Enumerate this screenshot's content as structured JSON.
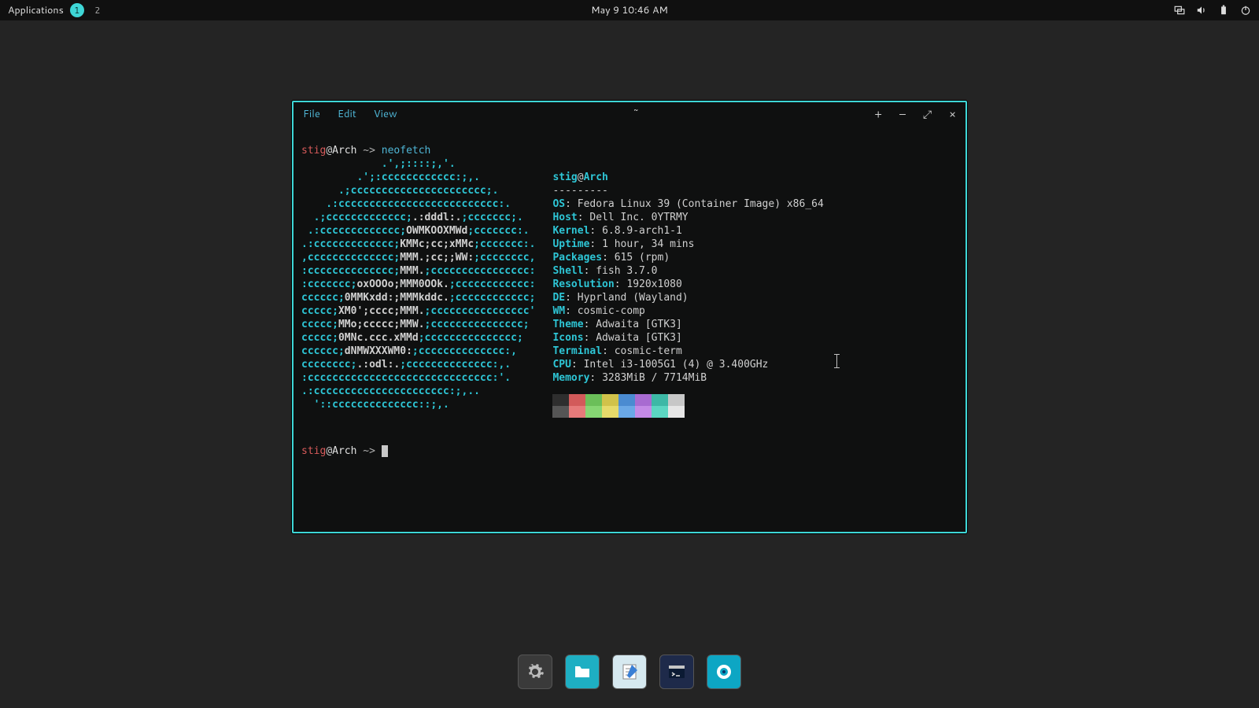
{
  "panel": {
    "applications_label": "Applications",
    "ws1": "1",
    "ws2": "2",
    "clock": "May 9 10:46 AM"
  },
  "tray": {
    "screen": "screen-icon",
    "volume": "volume-icon",
    "battery": "battery-icon",
    "power": "power-icon"
  },
  "window": {
    "menu_file": "File",
    "menu_edit": "Edit",
    "menu_view": "View",
    "title": "~",
    "btn_newtab": "+",
    "btn_min": "–",
    "btn_max": "⤢",
    "btn_close": "×"
  },
  "shell": {
    "prompt_user": "stig",
    "prompt_at": "@",
    "prompt_host": "Arch",
    "prompt_path": "~>",
    "command": "neofetch"
  },
  "neofetch": {
    "header_user": "stig",
    "header_at": "@",
    "header_host": "Arch",
    "dashes": "---------",
    "os_label": "OS",
    "os_value": "Fedora Linux 39 (Container Image) x86_64",
    "host_label": "Host",
    "host_value": "Dell Inc. 0YTRMY",
    "kernel_label": "Kernel",
    "kernel_value": "6.8.9-arch1-1",
    "uptime_label": "Uptime",
    "uptime_value": "1 hour, 34 mins",
    "packages_label": "Packages",
    "packages_value": "615 (rpm)",
    "shell_label": "Shell",
    "shell_value": "fish 3.7.0",
    "resolution_label": "Resolution",
    "resolution_value": "1920x1080",
    "de_label": "DE",
    "de_value": "Hyprland (Wayland)",
    "wm_label": "WM",
    "wm_value": "cosmic-comp",
    "theme_label": "Theme",
    "theme_value": "Adwaita [GTK3]",
    "icons_label": "Icons",
    "icons_value": "Adwaita [GTK3]",
    "terminal_label": "Terminal",
    "terminal_value": "cosmic-term",
    "cpu_label": "CPU",
    "cpu_value": "Intel i3-1005G1 (4) @ 3.400GHz",
    "memory_label": "Memory",
    "memory_value": "3283MiB / 7714MiB",
    "palette_row1": [
      "#2e2e2e",
      "#d25a5a",
      "#6bbf59",
      "#d1c24a",
      "#4a8bd1",
      "#a86bd1",
      "#3db8a6",
      "#c7c7c7"
    ],
    "palette_row2": [
      "#555555",
      "#e67a7a",
      "#86d673",
      "#e6da6a",
      "#6aa8e6",
      "#c48ae6",
      "#5bd6c2",
      "#e6e6e6"
    ]
  },
  "ascii": {
    "l1": "             .',;::::;,'.",
    "l2": "         .';:cccccccccccc:;,.",
    "l3": "      .;cccccccccccccccccccccc;.",
    "l4": "    .:cccccccccccccccccccccccccc:.",
    "l5a": {
      "pre": "  .;ccccccccccccc;",
      "mid": ".:dddl:.",
      "post": ";ccccccc;."
    },
    "l6a": {
      "pre": " .:ccccccccccccc;",
      "mid": "OWMKOOXMWd",
      "post": ";ccccccc:."
    },
    "l7a": {
      "pre": ".:ccccccccccccc;",
      "mid": "KMMc;cc;xMMc",
      "post": ";ccccccc:."
    },
    "l8a": {
      "pre": ",cccccccccccccc;",
      "mid": "MMM.;cc;;WW:",
      "post": ";cccccccc,"
    },
    "l9a": {
      "pre": ":cccccccccccccc;",
      "mid": "MMM.",
      "post": ";cccccccccccccccc:"
    },
    "l10a": {
      "pre": ":ccccccc;",
      "mid": "oxOOOo;MMM0OOk.",
      "post": ";cccccccccccc:"
    },
    "l11a": {
      "pre": "cccccc;",
      "mid": "0MMKxdd:;MMMkddc.",
      "post": ";cccccccccccc;"
    },
    "l12a": {
      "pre": "ccccc;",
      "mid": "XM0';cccc;MMM.",
      "post": ";cccccccccccccccc'"
    },
    "l13a": {
      "pre": "ccccc;",
      "mid": "MMo;ccccc;MMW.",
      "post": ";ccccccccccccccc;"
    },
    "l14a": {
      "pre": "ccccc;",
      "mid": "0MNc.ccc.xMMd",
      "post": ";ccccccccccccccc;"
    },
    "l15a": {
      "pre": "cccccc;",
      "mid": "dNMWXXXWM0:",
      "post": ";cccccccccccccc:,"
    },
    "l16a": {
      "pre": "cccccccc;",
      "mid": ".:odl:.",
      "post": ";cccccccccccccc:,."
    },
    "l17": ":cccccccccccccccccccccccccccccc:'.",
    "l18": ".:cccccccccccccccccccccc:;,..",
    "l19": "  '::cccccccccccccc::;,."
  },
  "dock": {
    "settings": "settings-icon",
    "files": "files-icon",
    "editor": "editor-icon",
    "terminal": "terminal-icon",
    "camera": "camera-icon"
  }
}
